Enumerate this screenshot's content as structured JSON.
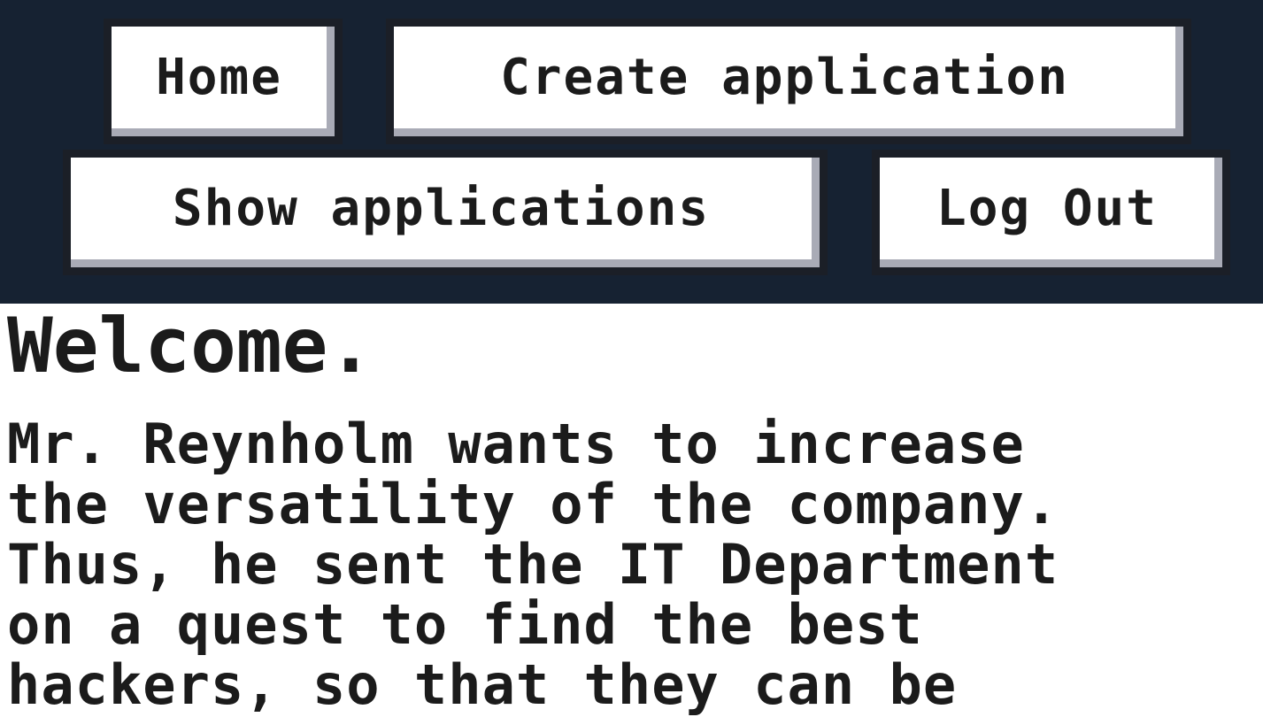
{
  "nav": {
    "home_label": "Home",
    "create_label": "Create application",
    "show_label": "Show applications",
    "logout_label": "Log Out"
  },
  "main": {
    "heading": "Welcome.",
    "intro_lines": [
      "Mr. Reynholm wants to increase",
      "the versatility of the company.",
      "Thus, he sent the IT Department",
      "on a quest to find the best",
      "hackers, so that they can be"
    ]
  },
  "colors": {
    "nav_background": "#162232",
    "button_face": "#ffffff",
    "button_shadow": "#a9abb6",
    "text": "#1b1b1b"
  }
}
